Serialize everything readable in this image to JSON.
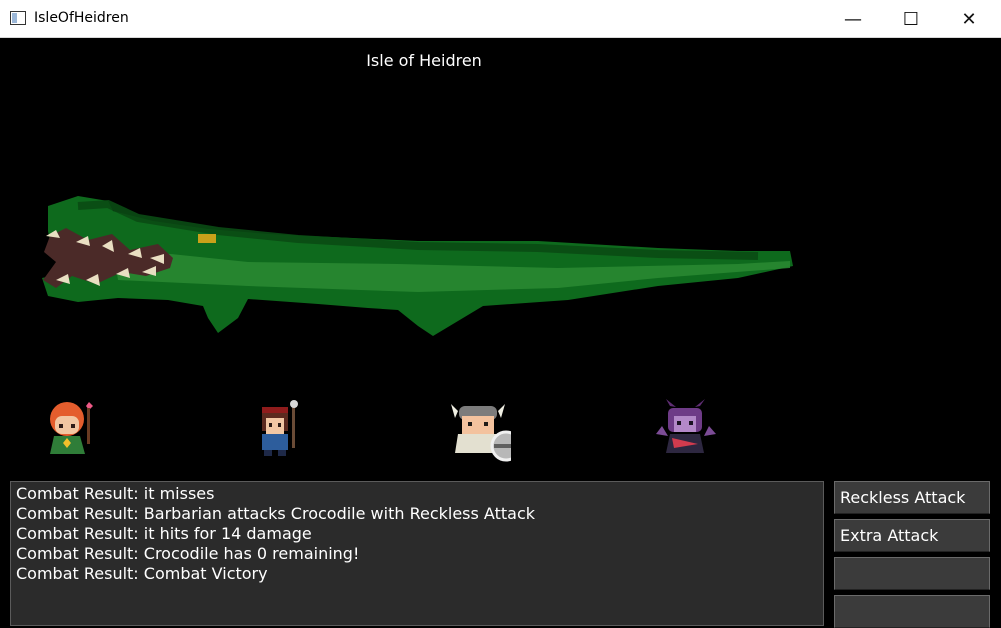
{
  "window": {
    "title": "IsleOfHeidren",
    "icon": "app-window-icon",
    "controls": {
      "minimize": "—",
      "maximize": "☐",
      "close": "✕"
    }
  },
  "game": {
    "title": "Isle of Heidren",
    "enemy_sprite": "crocodile-sprite",
    "party_sprites": [
      "druid-sprite",
      "ranger-sprite",
      "barbarian-sprite",
      "warlock-sprite"
    ]
  },
  "combat_log": [
    "Combat Result: it misses",
    "Combat Result: Barbarian attacks Crocodile with Reckless Attack",
    "Combat Result: it hits for 14 damage",
    "Combat Result: Crocodile has 0 remaining!",
    "Combat Result: Combat Victory"
  ],
  "actions": [
    "Reckless Attack",
    "Extra Attack",
    "",
    ""
  ],
  "colors": {
    "background": "#000000",
    "panel": "#2b2b2b",
    "button": "#3b3b3b",
    "crocodile": "#0f6b1f",
    "text": "#ffffff"
  }
}
